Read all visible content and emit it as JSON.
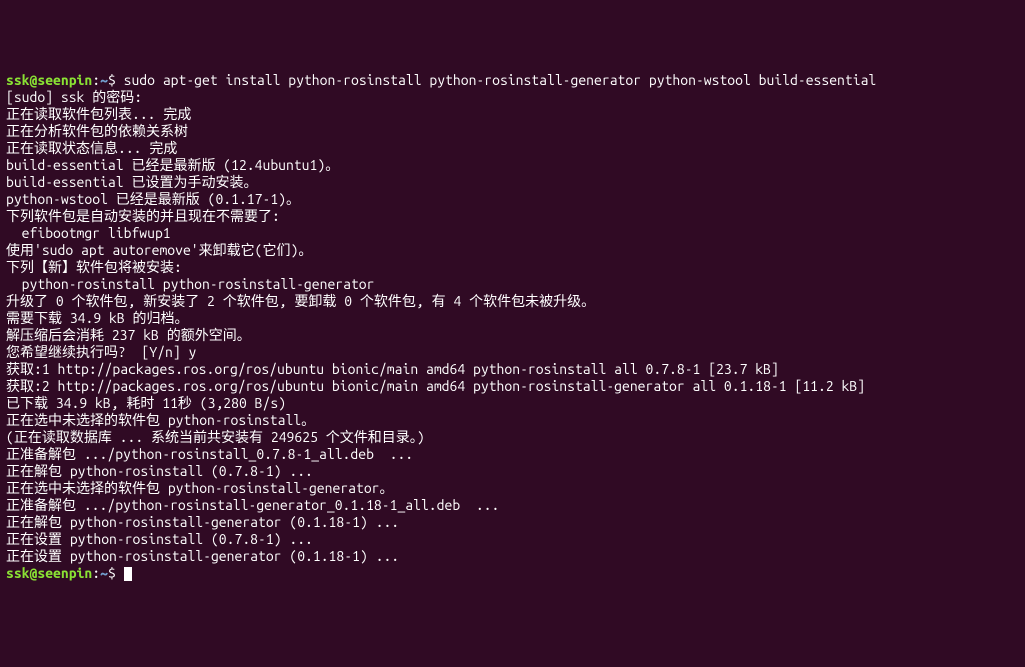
{
  "prompt1": {
    "user": "ssk@seenpin",
    "sep1": ":",
    "path": "~",
    "sep2": "$ ",
    "command": "sudo apt-get install python-rosinstall python-rosinstall-generator python-wstool build-essential"
  },
  "lines": [
    "[sudo] ssk 的密码:",
    "正在读取软件包列表... 完成",
    "正在分析软件包的依赖关系树",
    "正在读取状态信息... 完成",
    "build-essential 已经是最新版 (12.4ubuntu1)。",
    "build-essential 已设置为手动安装。",
    "python-wstool 已经是最新版 (0.1.17-1)。",
    "下列软件包是自动安装的并且现在不需要了:",
    "  efibootmgr libfwup1",
    "使用'sudo apt autoremove'来卸载它(它们)。",
    "下列【新】软件包将被安装:",
    "  python-rosinstall python-rosinstall-generator",
    "升级了 0 个软件包, 新安装了 2 个软件包, 要卸载 0 个软件包, 有 4 个软件包未被升级。",
    "需要下载 34.9 kB 的归档。",
    "解压缩后会消耗 237 kB 的额外空间。",
    "您希望继续执行吗?  [Y/n] y",
    "获取:1 http://packages.ros.org/ros/ubuntu bionic/main amd64 python-rosinstall all 0.7.8-1 [23.7 kB]",
    "获取:2 http://packages.ros.org/ros/ubuntu bionic/main amd64 python-rosinstall-generator all 0.1.18-1 [11.2 kB]",
    "已下载 34.9 kB, 耗时 11秒 (3,280 B/s)",
    "正在选中未选择的软件包 python-rosinstall。",
    "(正在读取数据库 ... 系统当前共安装有 249625 个文件和目录。)",
    "正准备解包 .../python-rosinstall_0.7.8-1_all.deb  ...",
    "正在解包 python-rosinstall (0.7.8-1) ...",
    "正在选中未选择的软件包 python-rosinstall-generator。",
    "正准备解包 .../python-rosinstall-generator_0.1.18-1_all.deb  ...",
    "正在解包 python-rosinstall-generator (0.1.18-1) ...",
    "正在设置 python-rosinstall (0.7.8-1) ...",
    "正在设置 python-rosinstall-generator (0.1.18-1) ..."
  ],
  "prompt2": {
    "user": "ssk@seenpin",
    "sep1": ":",
    "path": "~",
    "sep2": "$ "
  }
}
